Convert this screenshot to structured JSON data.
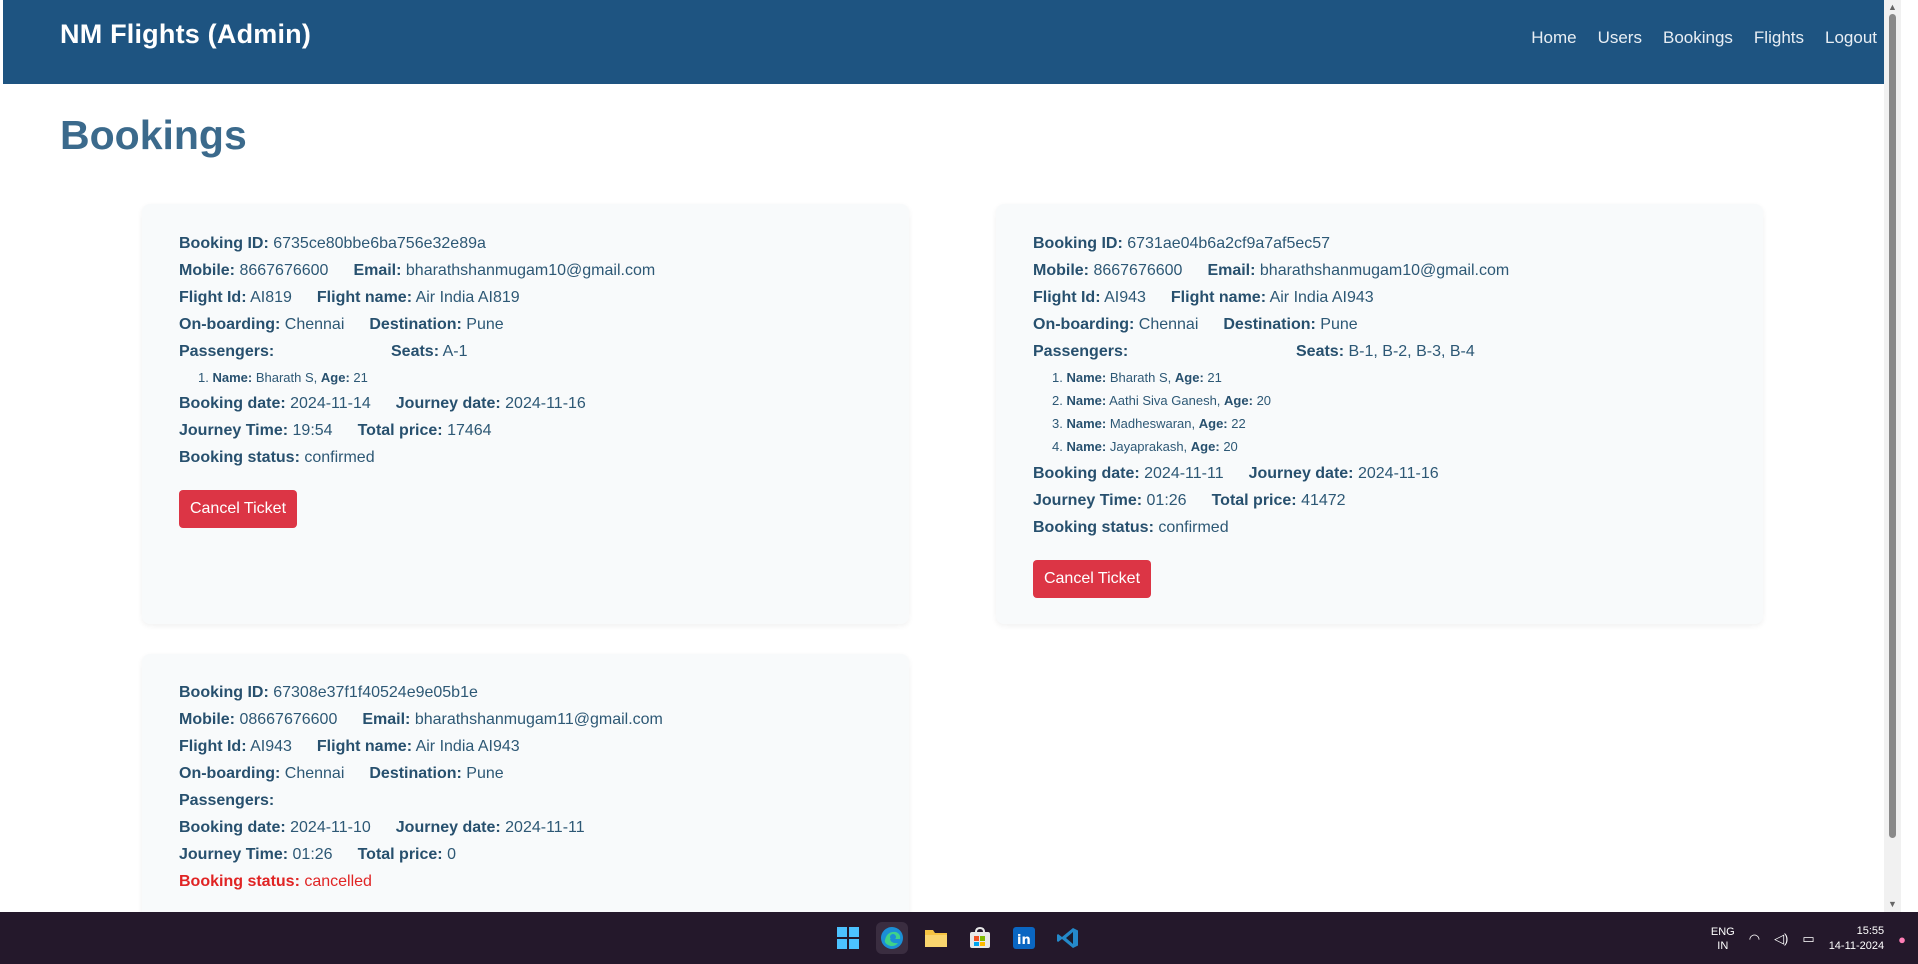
{
  "brand": "NM Flights (Admin)",
  "nav": [
    "Home",
    "Users",
    "Bookings",
    "Flights",
    "Logout"
  ],
  "page_title": "Bookings",
  "labels": {
    "booking_id": "Booking ID:",
    "mobile": "Mobile:",
    "email": "Email:",
    "flight_id": "Flight Id:",
    "flight_name": "Flight name:",
    "onboarding": "On-boarding:",
    "destination": "Destination:",
    "passengers": "Passengers:",
    "seats": "Seats:",
    "booking_date": "Booking date:",
    "journey_date": "Journey date:",
    "journey_time": "Journey Time:",
    "total_price": "Total price:",
    "booking_status": "Booking status:",
    "pax_name": "Name:",
    "pax_age": "Age:"
  },
  "cancel_label": "Cancel Ticket",
  "bookings": [
    {
      "id": "6735ce80bbe6ba756e32e89a",
      "mobile": "8667676600",
      "email": "bharathshanmugam10@gmail.com",
      "flight_id": "AI819",
      "flight_name": "Air India AI819",
      "onboarding": "Chennai",
      "destination": "Pune",
      "seats": "A-1",
      "passengers": [
        {
          "num": "1.",
          "name": "Bharath S,",
          "age": "21"
        }
      ],
      "booking_date": "2024-11-14",
      "journey_date": "2024-11-16",
      "journey_time": "19:54",
      "total_price": "17464",
      "status": "confirmed"
    },
    {
      "id": "6731ae04b6a2cf9a7af5ec57",
      "mobile": "8667676600",
      "email": "bharathshanmugam10@gmail.com",
      "flight_id": "AI943",
      "flight_name": "Air India AI943",
      "onboarding": "Chennai",
      "destination": "Pune",
      "seats": "B-1, B-2, B-3, B-4",
      "passengers": [
        {
          "num": "1.",
          "name": "Bharath S,",
          "age": "21"
        },
        {
          "num": "2.",
          "name": "Aathi Siva Ganesh,",
          "age": "20"
        },
        {
          "num": "3.",
          "name": "Madheswaran,",
          "age": "22"
        },
        {
          "num": "4.",
          "name": "Jayaprakash,",
          "age": "20"
        }
      ],
      "booking_date": "2024-11-11",
      "journey_date": "2024-11-16",
      "journey_time": "01:26",
      "total_price": "41472",
      "status": "confirmed"
    },
    {
      "id": "67308e37f1f40524e9e05b1e",
      "mobile": "08667676600",
      "email": "bharathshanmugam11@gmail.com",
      "flight_id": "AI943",
      "flight_name": "Air India AI943",
      "onboarding": "Chennai",
      "destination": "Pune",
      "seats": "",
      "passengers": [],
      "booking_date": "2024-11-10",
      "journey_date": "2024-11-11",
      "journey_time": "01:26",
      "total_price": "0",
      "status": "cancelled"
    }
  ],
  "taskbar": {
    "apps": [
      "windows-start-icon",
      "edge-icon",
      "file-explorer-icon",
      "store-icon",
      "linkedin-icon",
      "vscode-icon"
    ],
    "lang_line1": "ENG",
    "lang_line2": "IN",
    "time": "15:55",
    "date": "14-11-2024"
  },
  "colors": {
    "navbar": "#1e5481",
    "cancel_button": "#dc3545",
    "cancelled_status": "#e02424"
  }
}
